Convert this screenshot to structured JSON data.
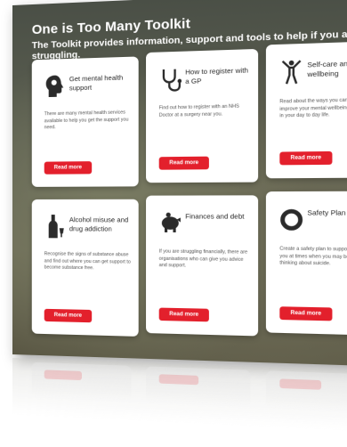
{
  "header": {
    "title": "One is Too Many Toolkit",
    "subtitle": "The Toolkit provides information, support and tools to help if you are struggling."
  },
  "accent_color": "#e3202c",
  "cards": [
    {
      "icon": "head-icon",
      "title": "Get mental health support",
      "description": "There are many mental health services available to help you get the support you need.",
      "button": "Read more"
    },
    {
      "icon": "stethoscope-icon",
      "title": "How to register with a GP",
      "description": "Find out how to register with an NHS Doctor at a surgery near you.",
      "button": "Read more"
    },
    {
      "icon": "person-stretch-icon",
      "title": "Self-care and wellbeing",
      "description": "Read about the ways you can improve your mental wellbeing in your day to day life.",
      "button": "Read more"
    },
    {
      "icon": "bottle-icon",
      "title": "Alcohol misuse and drug addiction",
      "description": "Recognise the signs of substance abuse and find out where you can get support to become substance free.",
      "button": "Read more"
    },
    {
      "icon": "piggy-bank-icon",
      "title": "Finances and debt",
      "description": "If you are struggling financially, there are organisations who can give you advice and support.",
      "button": "Read more"
    },
    {
      "icon": "lifebuoy-icon",
      "title": "Safety Plan",
      "description": "Create a safety plan to support you at times when you may be thinking about suicide.",
      "button": "Read more"
    }
  ]
}
